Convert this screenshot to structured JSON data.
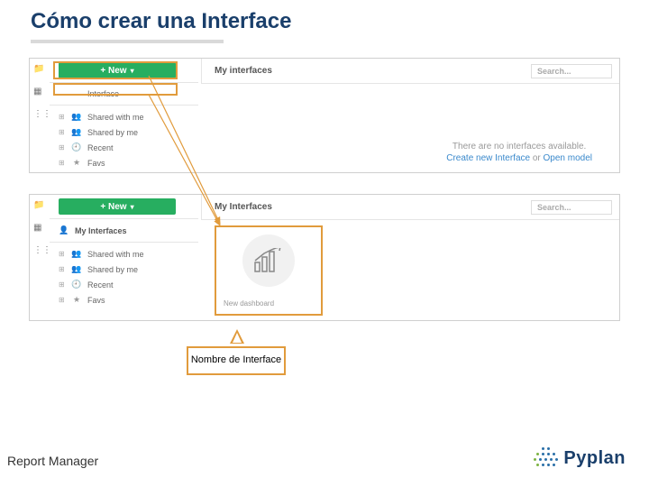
{
  "title": "Cómo crear una Interface",
  "panel1": {
    "new_button": "+ New",
    "interface_label": "Interface",
    "items": [
      {
        "icon": "👥",
        "label": "Shared with me"
      },
      {
        "icon": "👥",
        "label": "Shared by me"
      },
      {
        "icon": "🕘",
        "label": "Recent"
      },
      {
        "icon": "★",
        "label": "Favs"
      }
    ],
    "header": "My interfaces",
    "search_placeholder": "Search...",
    "empty_text": "There are no interfaces available.",
    "empty_link1": "Create new Interface",
    "empty_or": " or ",
    "empty_link2": "Open model"
  },
  "panel2": {
    "new_button": "+ New",
    "my_label": "My Interfaces",
    "items": [
      {
        "icon": "👥",
        "label": "Shared with me"
      },
      {
        "icon": "👥",
        "label": "Shared by me"
      },
      {
        "icon": "🕘",
        "label": "Recent"
      },
      {
        "icon": "★",
        "label": "Favs"
      }
    ],
    "header": "My Interfaces",
    "search_placeholder": "Search...",
    "thumb_label": "New dashboard"
  },
  "callout": "Nombre de Interface",
  "footer_left": "Report Manager",
  "footer_brand": "Pyplan"
}
